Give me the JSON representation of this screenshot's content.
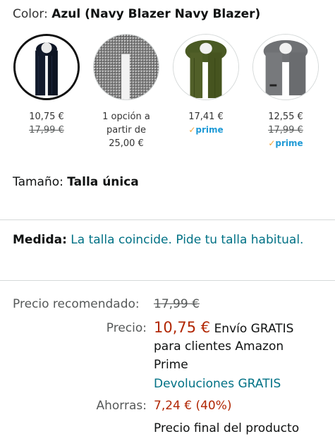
{
  "color": {
    "label": "Color:",
    "value": "Azul (Navy Blazer Navy Blazer)"
  },
  "options": [
    {
      "price": "10,75 €",
      "old_price": "17,99 €",
      "prime": ""
    },
    {
      "line1": "1 opción a",
      "line2": "partir de",
      "line3": "25,00 €"
    },
    {
      "price": "17,41 €",
      "old_price": "",
      "prime": "prime"
    },
    {
      "price": "12,55 €",
      "old_price": "17,99 €",
      "prime": "prime"
    }
  ],
  "prime_check": "✓",
  "size": {
    "label": "Tamaño:",
    "value": "Talla única"
  },
  "medida": {
    "label": "Medida:",
    "text": "La talla coincide. Pide tu talla habitual."
  },
  "pricing": {
    "rec_label": "Precio recomendado:",
    "rec_value": "17,99 €",
    "price_label": "Precio:",
    "price_value": "10,75 €",
    "shipping": "Envío GRATIS",
    "shipping_line2": "para clientes Amazon",
    "shipping_line3": "Prime",
    "returns": "Devoluciones GRATIS",
    "savings_label": "Ahorras:",
    "savings_value": "7,24 € (40%)",
    "final_note": "Precio final del producto"
  },
  "colors": {
    "link": "#007185",
    "price": "#b12704",
    "prime": "#1f9ad6"
  }
}
